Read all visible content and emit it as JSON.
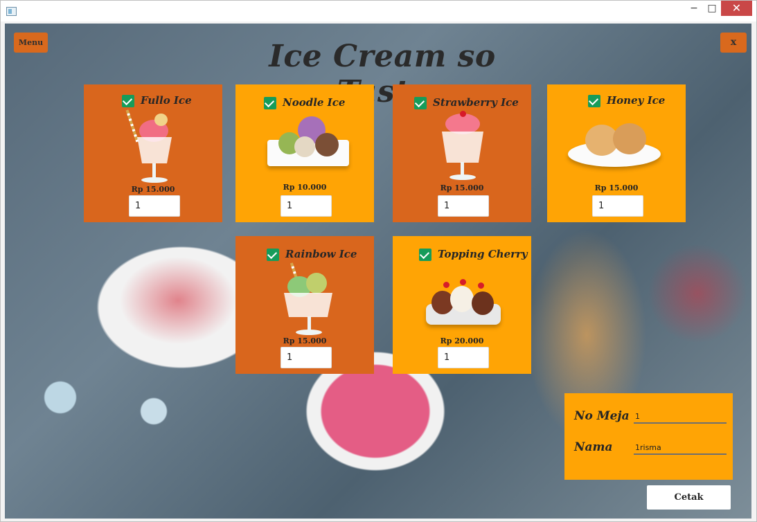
{
  "window": {
    "minimize_icon": "minimize-icon",
    "maximize_icon": "maximize-icon",
    "close_icon": "close-icon"
  },
  "header": {
    "menu_label": "Menu",
    "close_label": "x",
    "title": "Ice Cream so Tasty"
  },
  "products": [
    {
      "name": "Fullo Ice",
      "price": "Rp 15.000",
      "qty": "1",
      "checked": true
    },
    {
      "name": "Noodle Ice",
      "price": "Rp 10.000",
      "qty": "1",
      "checked": true
    },
    {
      "name": "Strawberry Ice",
      "price": "Rp 15.000",
      "qty": "1",
      "checked": true
    },
    {
      "name": "Honey Ice",
      "price": "Rp 15.000",
      "qty": "1",
      "checked": true
    },
    {
      "name": "Rainbow Ice",
      "price": "Rp 15.000",
      "qty": "1",
      "checked": true
    },
    {
      "name": "Topping Cherry",
      "price": "Rp 20.000",
      "qty": "1",
      "checked": true
    }
  ],
  "order": {
    "table_label": "No Meja",
    "table_value": "1",
    "name_label": "Nama",
    "name_value": "1risma",
    "submit_label": "Cetak"
  },
  "colors": {
    "orange": "#d9661d",
    "gold": "#ffa405",
    "check": "#169c5a"
  }
}
